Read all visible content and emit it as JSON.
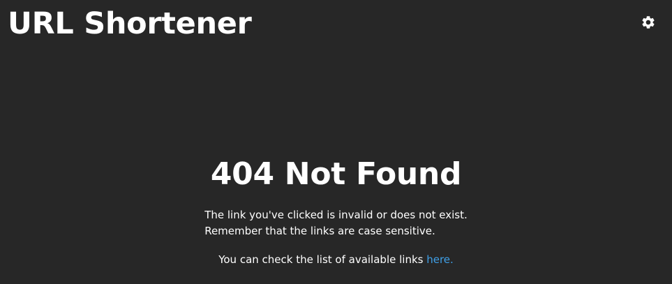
{
  "header": {
    "title": "URL Shortener",
    "settings_icon": "gear-icon"
  },
  "main": {
    "heading": "404 Not Found",
    "message_line_1": "The link you've clicked is invalid or does not exist.",
    "message_line_2": "Remember that the links are case sensitive.",
    "links_text": "You can check the list of available links ",
    "links_link_text": "here."
  },
  "colors": {
    "background": "#272727",
    "text": "#ffffff",
    "link": "#3fa0e8"
  }
}
